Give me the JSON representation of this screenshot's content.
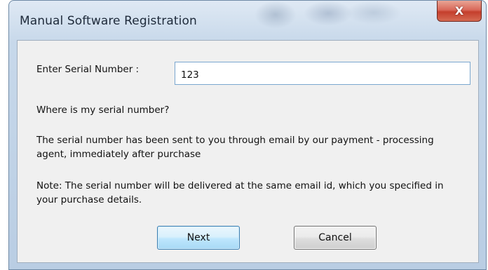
{
  "window": {
    "title": "Manual Software Registration",
    "close_glyph": "X"
  },
  "form": {
    "serial_label": "Enter Serial Number :",
    "serial_value": "123",
    "where_label": "Where is my serial number?",
    "info_text": "The serial number has been sent to you through email by our payment - processing agent, immediately after purchase",
    "note_text": "Note: The serial number will be delivered at the same email id, which you specified in your purchase details."
  },
  "buttons": {
    "next_label": "Next",
    "cancel_label": "Cancel"
  },
  "colors": {
    "title_bar": "#c7d8ea",
    "close_button": "#c43f2d",
    "client_area": "#f0f0f0",
    "default_button_border": "#3c7fb1"
  },
  "icons": {
    "close": "close-icon"
  }
}
